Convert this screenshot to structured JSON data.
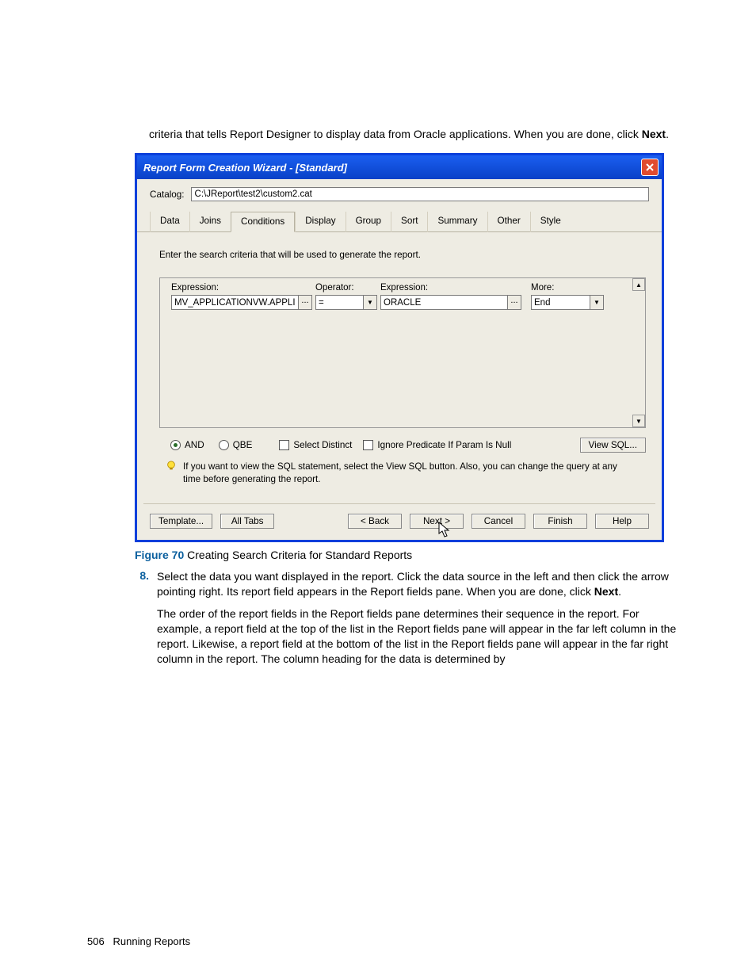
{
  "intro": {
    "pre": "criteria that tells Report Designer to display data from Oracle applications. When you are done, click ",
    "bold": "Next",
    "post": "."
  },
  "dialog": {
    "title": "Report Form Creation Wizard - [Standard]",
    "catalog_label": "Catalog:",
    "catalog_value": "C:\\JReport\\test2\\custom2.cat",
    "tabs": [
      "Data",
      "Joins",
      "Conditions",
      "Display",
      "Group",
      "Sort",
      "Summary",
      "Other",
      "Style"
    ],
    "active_tab_index": 2,
    "instruction": "Enter the search criteria that will be used to generate the report.",
    "headers": {
      "expr1": "Expression:",
      "op": "Operator:",
      "expr2": "Expression:",
      "more": "More:"
    },
    "row": {
      "expr1": "MV_APPLICATIONVW.APPLI",
      "op": "=",
      "expr2": "ORACLE",
      "more": "End"
    },
    "ellipsis": "...",
    "options": {
      "and": "AND",
      "qbe": "QBE",
      "select_distinct": "Select Distinct",
      "ignore_predicate": "Ignore Predicate If Param Is Null",
      "view_sql": "View SQL..."
    },
    "hint": "If you want to view the SQL statement, select the View SQL button.  Also, you can change the query at any time before generating the report.",
    "buttons": {
      "template": "Template...",
      "alltabs": "All Tabs",
      "back": "< Back",
      "next": "Next >",
      "cancel": "Cancel",
      "finish": "Finish",
      "help": "Help"
    }
  },
  "figure": {
    "num": "Figure 70",
    "caption": " Creating Search Criteria for Standard Reports"
  },
  "step8": {
    "num": "8.",
    "text_pre": "Select the data you want displayed in the report. Click the data source in the left and then click the arrow pointing right. Its report field appears in the Report fields pane. When you are done, click ",
    "bold": "Next",
    "text_post": "."
  },
  "follow": "The order of the report fields in the Report fields pane determines their sequence in the report. For example, a report field at the top of the list in the Report fields pane will appear in the far left column in the report. Likewise, a report field at the bottom of the list in the Report fields pane will appear in the far right column in the report. The column heading for the data is determined by",
  "footer": {
    "page": "506",
    "section": "Running Reports"
  }
}
